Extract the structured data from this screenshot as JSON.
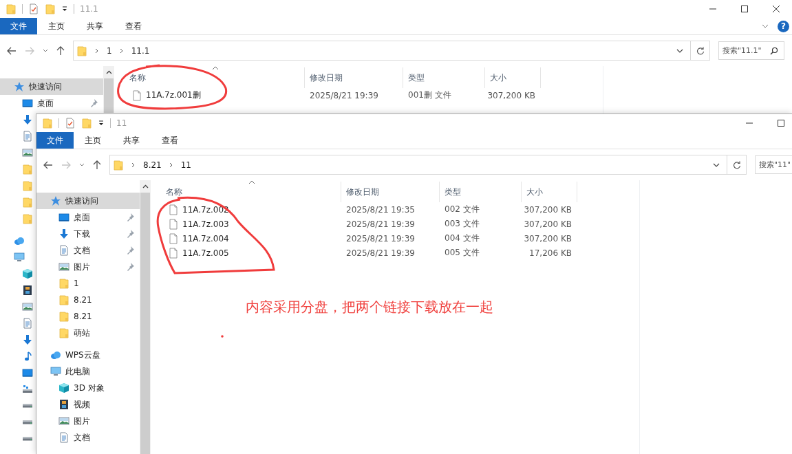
{
  "back_window": {
    "title": "11.1",
    "window_buttons": [
      {
        "kind": "minimize"
      },
      {
        "kind": "maximize"
      },
      {
        "kind": "close"
      }
    ],
    "ribbon_tabs": [
      {
        "label": "文件",
        "selected": true
      },
      {
        "label": "主页",
        "selected": false
      },
      {
        "label": "共享",
        "selected": false
      },
      {
        "label": "查看",
        "selected": false
      }
    ],
    "help_button": "?",
    "path": [
      "1",
      "11.1"
    ],
    "search": {
      "placeholder": "搜索\"11.1\""
    },
    "sidebar": [
      {
        "kind": "quick-access",
        "label": "快速访问",
        "selected": true,
        "children": [
          {
            "kind": "desktop",
            "label": "桌面",
            "pinned": true,
            "selected": false
          },
          {
            "kind": "download",
            "selected": false
          },
          {
            "kind": "document",
            "selected": false
          },
          {
            "kind": "picture",
            "selected": false
          },
          {
            "kind": "folder",
            "selected": false
          },
          {
            "kind": "folder",
            "selected": false
          },
          {
            "kind": "folder",
            "selected": false
          },
          {
            "kind": "folder",
            "selected": false
          }
        ]
      },
      {
        "kind": "cloud",
        "selected": false
      },
      {
        "kind": "pc",
        "selected": false,
        "children": [
          {
            "kind": "cube",
            "selected": false
          },
          {
            "kind": "video",
            "selected": false
          },
          {
            "kind": "picture",
            "selected": false
          },
          {
            "kind": "document",
            "selected": false
          },
          {
            "kind": "download",
            "selected": false
          },
          {
            "kind": "music",
            "selected": false
          },
          {
            "kind": "desktop",
            "selected": false
          },
          {
            "kind": "netdrive",
            "selected": false
          },
          {
            "kind": "drive",
            "selected": false
          },
          {
            "kind": "drive",
            "selected": false
          },
          {
            "kind": "drive",
            "selected": false
          }
        ]
      }
    ],
    "columns": [
      "名称",
      "修改日期",
      "类型",
      "大小"
    ],
    "rows": [
      {
        "name": "11A.7z.001删",
        "modified": "2025/8/21 19:39",
        "type": "001删 文件",
        "size": "307,200 KB"
      }
    ]
  },
  "front_window": {
    "title": "11",
    "window_buttons": [
      {
        "kind": "minimize"
      },
      {
        "kind": "maximize"
      }
    ],
    "ribbon_tabs": [
      {
        "label": "文件",
        "selected": true
      },
      {
        "label": "主页",
        "selected": false
      },
      {
        "label": "共享",
        "selected": false
      },
      {
        "label": "查看",
        "selected": false
      }
    ],
    "path": [
      "8.21",
      "11"
    ],
    "search": {
      "placeholder": "搜索\"11\""
    },
    "sidebar": [
      {
        "kind": "quick-access",
        "label": "快速访问",
        "selected": true,
        "children": [
          {
            "kind": "desktop",
            "label": "桌面",
            "pinned": true,
            "selected": false
          },
          {
            "kind": "download",
            "label": "下载",
            "pinned": true,
            "selected": false
          },
          {
            "kind": "document",
            "label": "文档",
            "pinned": true,
            "selected": false
          },
          {
            "kind": "picture",
            "label": "图片",
            "pinned": true,
            "selected": false
          },
          {
            "kind": "folder",
            "label": "1",
            "selected": false
          },
          {
            "kind": "folder",
            "label": "8.21",
            "selected": false
          },
          {
            "kind": "folder",
            "label": "8.21",
            "selected": false
          },
          {
            "kind": "folder",
            "label": "萌站",
            "selected": false
          }
        ]
      },
      {
        "kind": "cloud",
        "label": "WPS云盘",
        "selected": false
      },
      {
        "kind": "pc",
        "label": "此电脑",
        "selected": false,
        "children": [
          {
            "kind": "cube",
            "label": "3D 对象",
            "selected": false
          },
          {
            "kind": "video",
            "label": "视频",
            "selected": false
          },
          {
            "kind": "picture",
            "label": "图片",
            "selected": false
          },
          {
            "kind": "document",
            "label": "文档",
            "selected": false
          }
        ]
      }
    ],
    "columns": [
      "名称",
      "修改日期",
      "类型",
      "大小"
    ],
    "rows": [
      {
        "name": "11A.7z.002",
        "modified": "2025/8/21 19:35",
        "type": "002 文件",
        "size": "307,200 KB"
      },
      {
        "name": "11A.7z.003",
        "modified": "2025/8/21 19:39",
        "type": "003 文件",
        "size": "307,200 KB"
      },
      {
        "name": "11A.7z.004",
        "modified": "2025/8/21 19:39",
        "type": "004 文件",
        "size": "307,200 KB"
      },
      {
        "name": "11A.7z.005",
        "modified": "2025/8/21 19:39",
        "type": "005 文件",
        "size": "17,206 KB"
      }
    ]
  },
  "annotation": {
    "note": "内容采用分盘，把两个链接下载放在一起"
  }
}
